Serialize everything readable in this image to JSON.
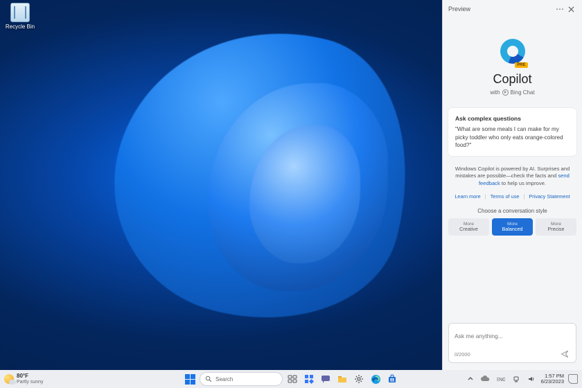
{
  "desktop": {
    "recycle_bin_label": "Recycle Bin"
  },
  "panel": {
    "header_title": "Preview",
    "hero": {
      "badge": "PRE",
      "title": "Copilot",
      "subtitle_prefix": "with",
      "subtitle_brand": "Bing Chat"
    },
    "card": {
      "title": "Ask complex questions",
      "example": "\"What are some meals I can make for my picky toddler who only eats orange-colored food?\""
    },
    "disclaimer_prefix": "Windows Copilot is powered by AI. Surprises and mistakes are possible—check the facts and ",
    "disclaimer_link": "send feedback",
    "disclaimer_suffix": " to help us improve.",
    "links": {
      "learn": "Learn more",
      "terms": "Terms of use",
      "privacy": "Privacy Statement"
    },
    "style_heading": "Choose a conversation style",
    "styles": [
      {
        "top": "More",
        "bottom": "Creative"
      },
      {
        "top": "More",
        "bottom": "Balanced"
      },
      {
        "top": "More",
        "bottom": "Precise"
      }
    ],
    "composer": {
      "placeholder": "Ask me anything...",
      "counter": "0/2000"
    }
  },
  "taskbar": {
    "weather": {
      "temp": "80°F",
      "condition": "Partly sunny"
    },
    "search_placeholder": "Search",
    "clock": {
      "time": "1:57 PM",
      "date": "6/23/2023"
    }
  }
}
